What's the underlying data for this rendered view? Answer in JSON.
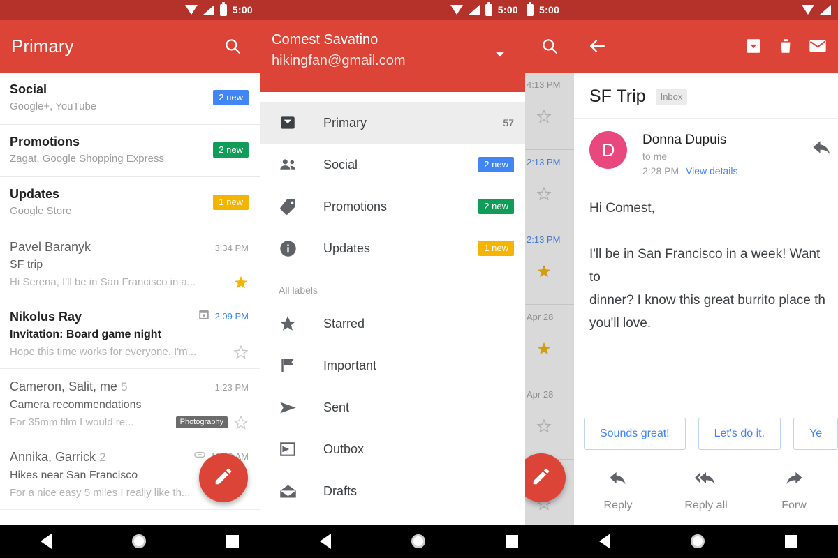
{
  "status_bar": {
    "time": "5:00",
    "icons": [
      "wifi-icon",
      "signal-icon",
      "battery-icon"
    ]
  },
  "colors": {
    "app_bar": "#db4437",
    "status_bar": "#b5322a",
    "badge_blue": "#4285f4",
    "badge_green": "#0f9d58",
    "badge_amber": "#f4b400",
    "accent_link": "#4285f4",
    "avatar_pink": "#e9487f",
    "star_gold": "#f4b400"
  },
  "panel1": {
    "app_bar": {
      "title": "Primary",
      "search_label": "Search"
    },
    "categories": [
      {
        "title": "Social",
        "subtitle": "Google+, YouTube",
        "badge": "2 new",
        "badge_color": "#4285f4"
      },
      {
        "title": "Promotions",
        "subtitle": "Zagat, Google Shopping Express",
        "badge": "2 new",
        "badge_color": "#0f9d58"
      },
      {
        "title": "Updates",
        "subtitle": "Google Store",
        "badge": "1 new",
        "badge_color": "#f4b400"
      }
    ],
    "emails": [
      {
        "from": "Pavel Baranyk",
        "count": "",
        "time": "3:34 PM",
        "time_blue": false,
        "subject": "SF trip",
        "snippet": "Hi Serena, I'll be in San Francisco in a...",
        "unread": false,
        "starred": true,
        "label": "",
        "has_calendar": false,
        "has_attachment": false
      },
      {
        "from": "Nikolus Ray",
        "count": "",
        "time": "2:09 PM",
        "time_blue": true,
        "subject": "Invitation: Board game night",
        "snippet": "Hope this time works for everyone. I'm...",
        "unread": true,
        "starred": false,
        "label": "",
        "has_calendar": true,
        "has_attachment": false
      },
      {
        "from": "Cameron, Salit, me",
        "count": "5",
        "time": "1:23 PM",
        "time_blue": false,
        "subject": "Camera recommendations",
        "snippet": "For 35mm film I would re...",
        "unread": false,
        "starred": false,
        "label": "Photography",
        "has_calendar": false,
        "has_attachment": false
      },
      {
        "from": "Annika, Garrick",
        "count": "2",
        "time": "11:42 AM",
        "time_blue": false,
        "subject": "Hikes near San Francisco",
        "snippet": "For a nice easy 5 miles I really like th...",
        "unread": false,
        "starred": false,
        "label": "",
        "has_calendar": false,
        "has_attachment": true
      }
    ],
    "fab": {
      "name": "compose",
      "icon": "pencil-icon"
    }
  },
  "panel2": {
    "account": {
      "name": "Comest Savatino",
      "email": "hikingfan@gmail.com",
      "caret": "chevron-down-icon"
    },
    "items": [
      {
        "label": "Primary",
        "icon": "inbox-icon",
        "count": "57",
        "badge": "",
        "badge_color": "",
        "selected": true
      },
      {
        "label": "Social",
        "icon": "people-icon",
        "count": "",
        "badge": "2 new",
        "badge_color": "#4285f4",
        "selected": false
      },
      {
        "label": "Promotions",
        "icon": "tag-icon",
        "count": "",
        "badge": "2 new",
        "badge_color": "#0f9d58",
        "selected": false
      },
      {
        "label": "Updates",
        "icon": "info-icon",
        "count": "",
        "badge": "1 new",
        "badge_color": "#f4b400",
        "selected": false
      }
    ],
    "section_label": "All labels",
    "labels": [
      {
        "label": "Starred",
        "icon": "star-icon"
      },
      {
        "label": "Important",
        "icon": "flag-icon"
      },
      {
        "label": "Sent",
        "icon": "send-icon"
      },
      {
        "label": "Outbox",
        "icon": "outbox-icon"
      },
      {
        "label": "Drafts",
        "icon": "draft-icon"
      }
    ]
  },
  "strip": {
    "search_label": "Search",
    "rows": [
      {
        "time": "4:13 PM",
        "time_blue": false,
        "starred": false
      },
      {
        "time": "2:13 PM",
        "time_blue": true,
        "starred": false
      },
      {
        "time": "2:13 PM",
        "time_blue": true,
        "starred": true
      },
      {
        "time": "Apr 28",
        "time_blue": false,
        "starred": true
      },
      {
        "time": "Apr 28",
        "time_blue": false,
        "starred": false
      }
    ],
    "fab": {
      "name": "compose",
      "icon": "pencil-icon"
    }
  },
  "panel3": {
    "app_bar": {
      "back": "back-arrow-icon",
      "actions": [
        "archive-icon",
        "delete-icon",
        "mail-icon"
      ]
    },
    "subject": "SF Trip",
    "label_chip": "Inbox",
    "message": {
      "avatar_letter": "D",
      "sender": "Donna Dupuis",
      "recipients": "to me",
      "time": "2:28 PM",
      "view_details": "View details",
      "reply_icon": "reply-icon",
      "body": "Hi Comest,\n\nI'll be in San Francisco in a week! Want to\ndinner? I know this great burrito place th\nyou'll love."
    },
    "smart_replies": [
      "Sounds great!",
      "Let's do it.",
      "Ye"
    ],
    "actions": [
      {
        "label": "Reply",
        "icon": "reply-icon"
      },
      {
        "label": "Reply all",
        "icon": "reply-all-icon"
      },
      {
        "label": "Forw",
        "icon": "forward-icon"
      }
    ]
  },
  "navbar": {
    "buttons": [
      "back-button",
      "home-button",
      "recents-button"
    ]
  }
}
